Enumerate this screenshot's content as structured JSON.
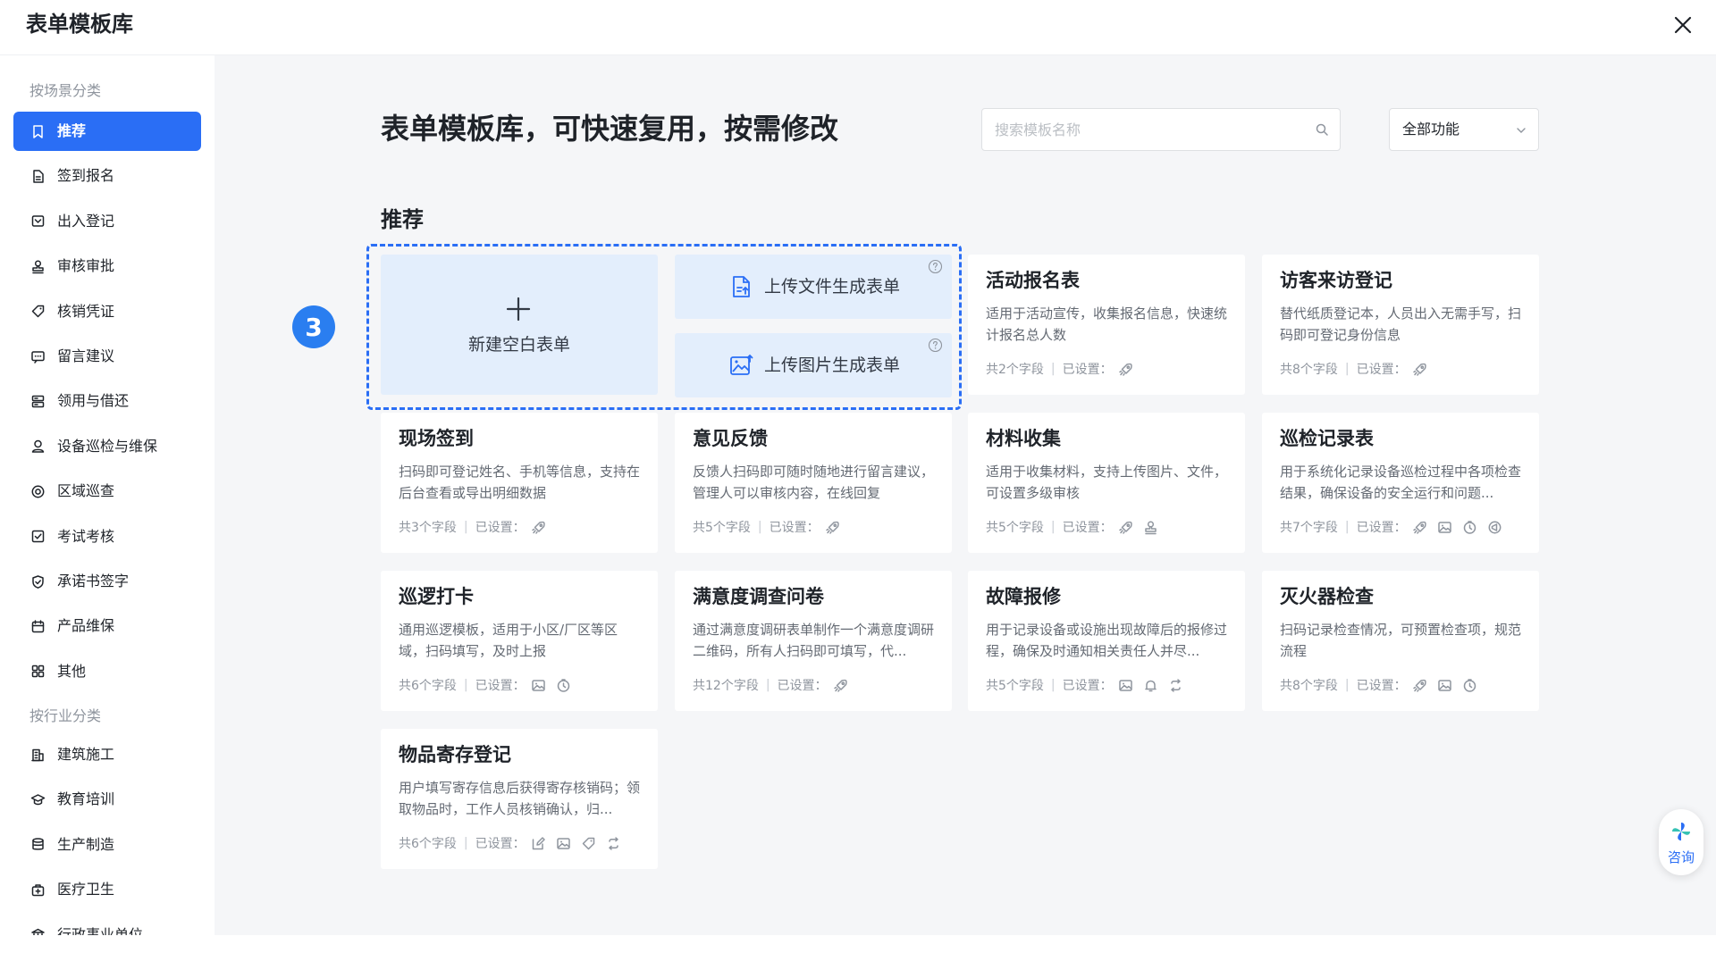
{
  "app": {
    "title": "表单模板库"
  },
  "sidebar": {
    "group_scene": "按场景分类",
    "group_industry": "按行业分类",
    "scene_items": [
      {
        "label": "推荐",
        "icon": "bookmark-icon",
        "active": true
      },
      {
        "label": "签到报名",
        "icon": "document-icon",
        "active": false
      },
      {
        "label": "出入登记",
        "icon": "inbox-icon",
        "active": false
      },
      {
        "label": "审核审批",
        "icon": "stamp-icon",
        "active": false
      },
      {
        "label": "核销凭证",
        "icon": "tag-icon",
        "active": false
      },
      {
        "label": "留言建议",
        "icon": "message-icon",
        "active": false
      },
      {
        "label": "领用与借还",
        "icon": "boxes-icon",
        "active": false
      },
      {
        "label": "设备巡检与维保",
        "icon": "location-person-icon",
        "active": false
      },
      {
        "label": "区域巡查",
        "icon": "target-icon",
        "active": false
      },
      {
        "label": "考试考核",
        "icon": "checkbox-icon",
        "active": false
      },
      {
        "label": "承诺书签字",
        "icon": "shield-check-icon",
        "active": false
      },
      {
        "label": "产品维保",
        "icon": "calendar-box-icon",
        "active": false
      },
      {
        "label": "其他",
        "icon": "grid-icon",
        "active": false
      }
    ],
    "industry_items": [
      {
        "label": "建筑施工",
        "icon": "building-icon"
      },
      {
        "label": "教育培训",
        "icon": "graduation-cap-icon"
      },
      {
        "label": "生产制造",
        "icon": "database-icon"
      },
      {
        "label": "医疗卫生",
        "icon": "medical-kit-icon"
      },
      {
        "label": "行政事业单位",
        "icon": "government-icon"
      }
    ]
  },
  "main": {
    "hero_title": "表单模板库，可快速复用，按需修改",
    "search_placeholder": "搜索模板名称",
    "filter_selected": "全部功能",
    "section_title": "推荐",
    "step_badge": "3",
    "create_blank_label": "新建空白表单",
    "upload_file_label": "上传文件生成表单",
    "upload_image_label": "上传图片生成表单"
  },
  "cards": [
    {
      "title": "活动报名表",
      "desc": "适用于活动宣传，收集报名信息，快速统计报名总人数",
      "fields": "共2个字段",
      "set_label": "已设置：",
      "feature_icons": [
        "rocket-icon"
      ]
    },
    {
      "title": "访客来访登记",
      "desc": "替代纸质登记本，人员出入无需手写，扫码即可登记身份信息",
      "fields": "共8个字段",
      "set_label": "已设置：",
      "feature_icons": [
        "rocket-icon"
      ]
    },
    {
      "title": "现场签到",
      "desc": "扫码即可登记姓名、手机等信息，支持在后台查看或导出明细数据",
      "fields": "共3个字段",
      "set_label": "已设置：",
      "feature_icons": [
        "rocket-icon"
      ]
    },
    {
      "title": "意见反馈",
      "desc": "反馈人扫码即可随时随地进行留言建议，管理人可以审核内容，在线回复",
      "fields": "共5个字段",
      "set_label": "已设置：",
      "feature_icons": [
        "rocket-icon"
      ]
    },
    {
      "title": "材料收集",
      "desc": "适用于收集材料，支持上传图片、文件，可设置多级审核",
      "fields": "共5个字段",
      "set_label": "已设置：",
      "feature_icons": [
        "rocket-icon",
        "stamp-icon"
      ]
    },
    {
      "title": "巡检记录表",
      "desc": "用于系统化记录设备巡检过程中各项检查结果，确保设备的安全运行和问题...",
      "fields": "共7个字段",
      "set_label": "已设置：",
      "feature_icons": [
        "rocket-icon",
        "image-icon",
        "timer-icon",
        "megaphone-icon"
      ]
    },
    {
      "title": "巡逻打卡",
      "desc": "通用巡逻模板，适用于小区/厂区等区域，扫码填写，及时上报",
      "fields": "共6个字段",
      "set_label": "已设置：",
      "feature_icons": [
        "image-icon",
        "timer-icon"
      ]
    },
    {
      "title": "满意度调查问卷",
      "desc": "通过满意度调研表单制作一个满意度调研二维码，所有人扫码即可填写，代...",
      "fields": "共12个字段",
      "set_label": "已设置：",
      "feature_icons": [
        "rocket-icon"
      ]
    },
    {
      "title": "故障报修",
      "desc": "用于记录设备或设施出现故障后的报修过程，确保及时通知相关责任人并尽...",
      "fields": "共5个字段",
      "set_label": "已设置：",
      "feature_icons": [
        "image-icon",
        "bell-icon",
        "loop-icon"
      ]
    },
    {
      "title": "灭火器检查",
      "desc": "扫码记录检查情况，可预置检查项，规范流程",
      "fields": "共8个字段",
      "set_label": "已设置：",
      "feature_icons": [
        "rocket-icon",
        "image-icon",
        "timer-icon"
      ]
    },
    {
      "title": "物品寄存登记",
      "desc": "用户填写寄存信息后获得寄存核销码；领取物品时，工作人员核销确认，归...",
      "fields": "共6个字段",
      "set_label": "已设置：",
      "feature_icons": [
        "edit-icon",
        "image-icon",
        "tag-icon",
        "loop-icon"
      ]
    }
  ],
  "consult": {
    "label": "咨询"
  },
  "colors": {
    "accent": "#2a6ef5",
    "create_bg": "#e3eefc",
    "badge": "#2a7ef0",
    "page_bg": "#f5f6f8"
  }
}
